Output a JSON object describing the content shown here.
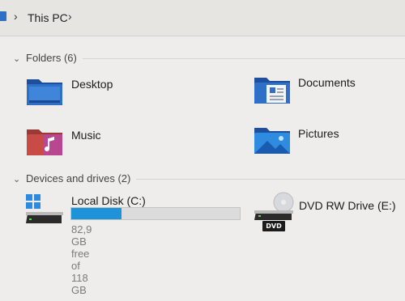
{
  "address": {
    "crumbs": [
      "This PC"
    ]
  },
  "folders": {
    "header": "Folders (6)",
    "items": [
      {
        "label": "Desktop",
        "icon": "desktop-folder-icon"
      },
      {
        "label": "Documents",
        "icon": "documents-folder-icon"
      },
      {
        "label": "Music",
        "icon": "music-folder-icon"
      },
      {
        "label": "Pictures",
        "icon": "pictures-folder-icon"
      }
    ]
  },
  "devices": {
    "header": "Devices and drives (2)",
    "items": [
      {
        "label": "Local Disk (C:)",
        "free_text": "82,9 GB free of 118 GB",
        "used_fraction": 0.3,
        "icon": "windows-drive-icon"
      },
      {
        "label": "DVD RW Drive (E:)",
        "badge": "DVD",
        "icon": "dvd-drive-icon"
      }
    ]
  },
  "colors": {
    "accent": "#1f93d9",
    "folder_blue": "#2e6fc7",
    "music_red": "#c84c45",
    "background": "#eeedeb"
  }
}
